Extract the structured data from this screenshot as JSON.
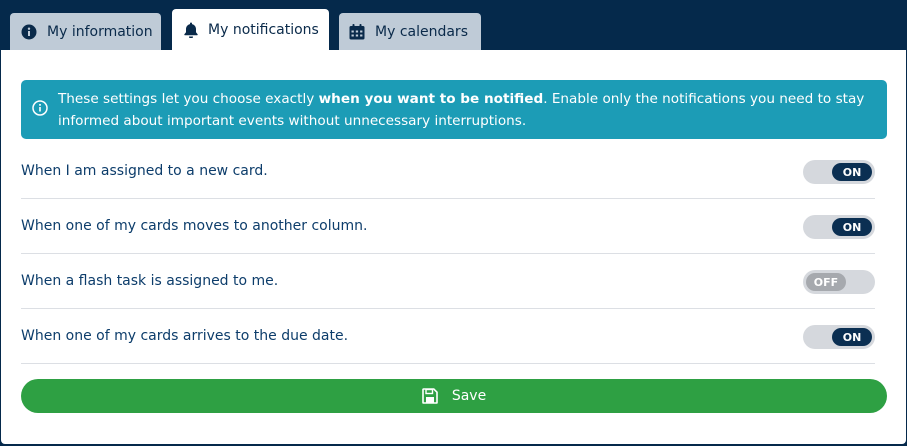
{
  "tabs": [
    {
      "label": "My information",
      "icon": "info-circle-icon",
      "active": false
    },
    {
      "label": "My notifications",
      "icon": "bell-icon",
      "active": true
    },
    {
      "label": "My calendars",
      "icon": "calendar-icon",
      "active": false
    }
  ],
  "alert": {
    "text_before": "These settings let you choose exactly ",
    "text_bold": "when you want to be notified",
    "text_after": ". Enable only the notifications you need to stay informed about important events without unnecessary interruptions.",
    "icon": "info-circle-icon",
    "background_color": "#1c9cb6"
  },
  "settings": [
    {
      "label": "When I am assigned to a new card.",
      "state": "ON"
    },
    {
      "label": "When one of my cards moves to another column.",
      "state": "ON"
    },
    {
      "label": "When a flash task is assigned to me.",
      "state": "OFF"
    },
    {
      "label": "When one of my cards arrives to the due date.",
      "state": "ON"
    }
  ],
  "save": {
    "label": "Save",
    "icon": "floppy-disk-icon",
    "color": "#2ea043"
  },
  "colors": {
    "background": "#05294b",
    "toggle_on": "#0b2f52",
    "toggle_off": "#a6a9ae"
  }
}
